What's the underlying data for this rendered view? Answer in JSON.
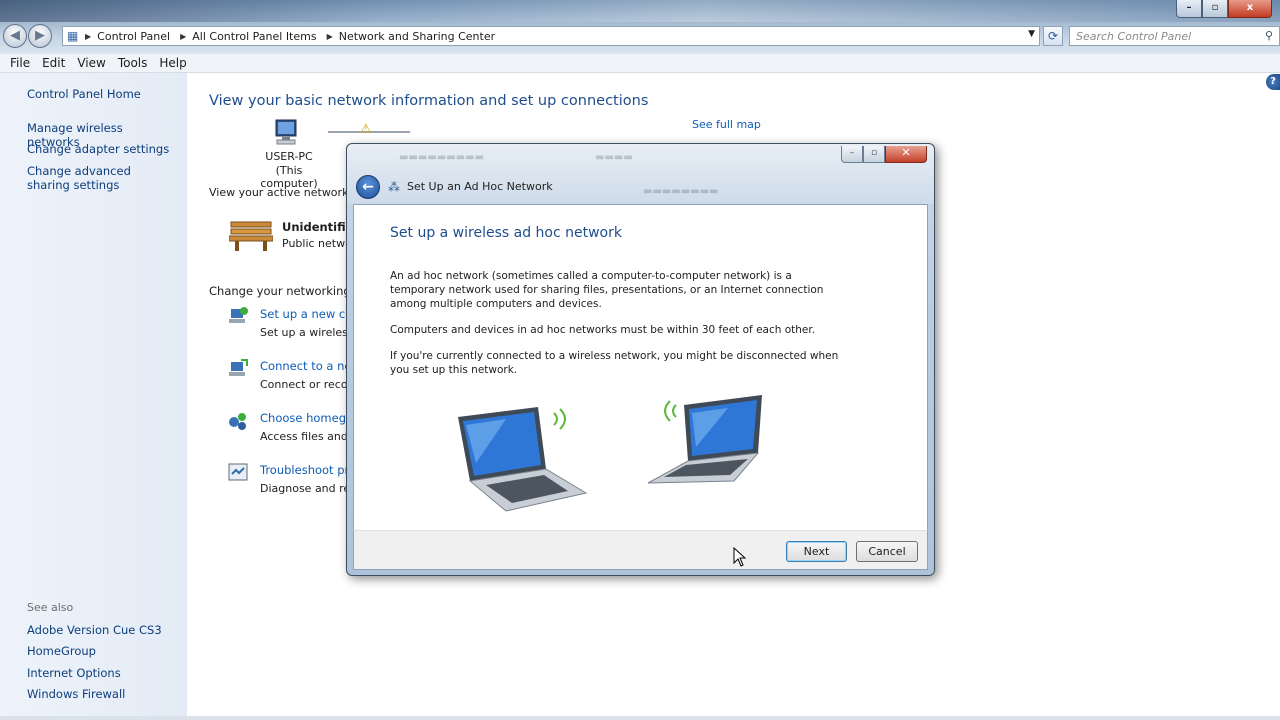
{
  "window": {
    "controls": {
      "minimize": "–",
      "maximize": "▫",
      "close": "x"
    }
  },
  "address_bar": {
    "breadcrumbs": [
      "Control Panel",
      "All Control Panel Items",
      "Network and Sharing Center"
    ],
    "search_placeholder": "Search Control Panel"
  },
  "menu": [
    "File",
    "Edit",
    "View",
    "Tools",
    "Help"
  ],
  "sidebar": {
    "items": [
      "Control Panel Home",
      "Manage wireless networks",
      "Change adapter settings",
      "Change advanced sharing settings"
    ],
    "see_also_label": "See also",
    "see_also": [
      "Adobe Version Cue CS3",
      "HomeGroup",
      "Internet Options",
      "Windows Firewall"
    ]
  },
  "main": {
    "title": "View your basic network information and set up connections",
    "see_full_map": "See full map",
    "map": {
      "computer_name": "USER-PC",
      "computer_sub": "(This computer)"
    },
    "active_networks_label": "View your active networks",
    "network_name": "Unidentified",
    "network_type": "Public netwo",
    "change_settings_label": "Change your networking se",
    "tasks": [
      {
        "link": "Set up a new con",
        "desc": "Set up a wireless,"
      },
      {
        "link": "Connect to a netv",
        "desc": "Connect or recon"
      },
      {
        "link": "Choose homegro",
        "desc": "Access files and p"
      },
      {
        "link": "Troubleshoot pro",
        "desc": "Diagnose and rep"
      }
    ]
  },
  "dialog": {
    "title": "Set Up an Ad Hoc Network",
    "heading": "Set up a wireless ad hoc network",
    "paragraphs": [
      "An ad hoc network (sometimes called a computer-to-computer network) is a temporary network used for sharing files, presentations, or an Internet connection among multiple computers and devices.",
      "Computers and devices in ad hoc networks must be within 30 feet of each other.",
      "If you're currently connected to a wireless network, you might be disconnected when you set up this network."
    ],
    "next_label": "Next",
    "cancel_label": "Cancel"
  }
}
